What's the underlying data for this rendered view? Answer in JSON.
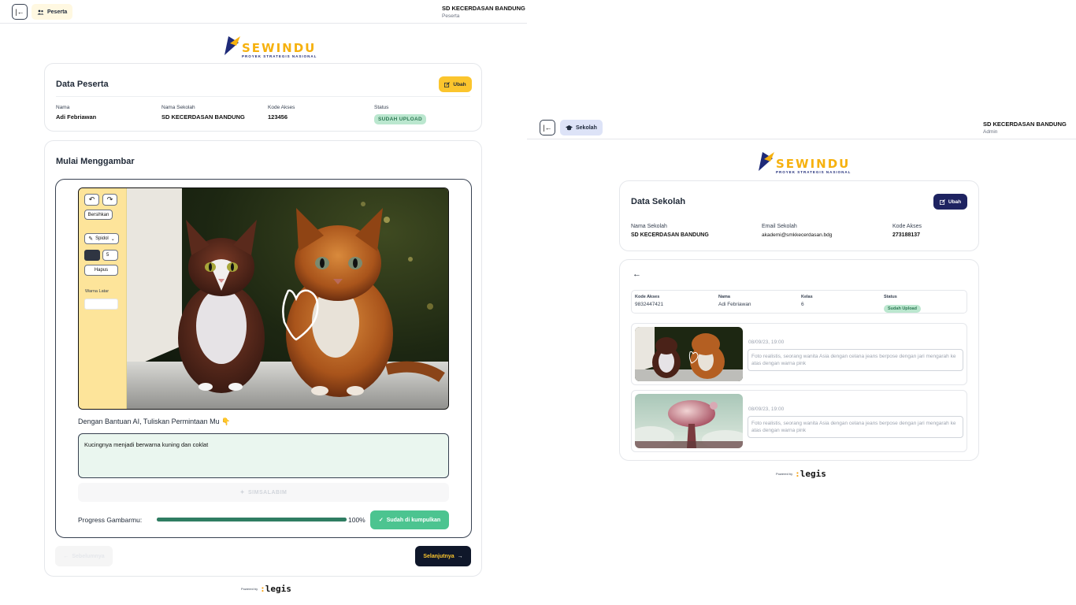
{
  "left": {
    "nav_chip": "Peserta",
    "org_name": "SD KECERDASAN BANDUNG",
    "org_role": "Peserta",
    "logo": {
      "word": "SEWINDU",
      "tagline": "PROYEK STRATEGIS NASIONAL"
    },
    "participant": {
      "title": "Data Peserta",
      "edit_label": "Ubah",
      "fields": [
        {
          "label": "Nama",
          "value": "Adi Febriawan"
        },
        {
          "label": "Nama Sekolah",
          "value": "SD KECERDASAN BANDUNG"
        },
        {
          "label": "Kode Akses",
          "value": "123456"
        },
        {
          "label": "Status",
          "value": "SUDAH UPLOAD"
        }
      ]
    },
    "drawing": {
      "title": "Mulai Menggambar",
      "tools": {
        "clear": "Bersihkan",
        "brush": "Spidol",
        "size": "5",
        "erase": "Hapus",
        "bg_label": "Warna Latar",
        "brush_color": "#2f3542",
        "bg_color": "#ffffff"
      },
      "prompt_label": "Dengan Bantuan AI, Tuliskan Permintaan Mu",
      "prompt_emoji": "👇",
      "prompt_value": "Kucingnya menjadi berwarna kuning dan coklat",
      "generate_label": "SIMSALABIM",
      "progress_label": "Progress Gambarmu:",
      "progress_value": 1.0,
      "progress_text": "100%",
      "submitted_label": "Sudah di kumpulkan"
    },
    "nav": {
      "prev_label": "Sebelumnya",
      "next_label": "Selanjutnya"
    },
    "powered": {
      "by": "Powered by",
      "brand": "legis"
    }
  },
  "right": {
    "nav_chip": "Sekolah",
    "org_name": "SD KECERDASAN BANDUNG",
    "org_role": "Admin",
    "logo": {
      "word": "SEWINDU",
      "tagline": "PROYEK STRATEGIS NASIONAL"
    },
    "school": {
      "title": "Data Sekolah",
      "edit_label": "Ubah",
      "fields": [
        {
          "label": "Nama Sekolah",
          "value": "SD KECERDASAN BANDUNG"
        },
        {
          "label": "Email Sekolah",
          "value": "akademi@smkkecerdasan.bdg"
        },
        {
          "label": "Kode Akses",
          "value": "273188137"
        }
      ]
    },
    "student": {
      "cols": [
        {
          "label": "Kode Akses",
          "value": "9832447421"
        },
        {
          "label": "Nama",
          "value": "Adi Febriawan"
        },
        {
          "label": "Kelas",
          "value": "6"
        },
        {
          "label": "Status",
          "value": "Sudah Upload"
        }
      ]
    },
    "history": [
      {
        "date": "08/09/23, 19:00",
        "desc": "Foto realistis, seorang wanita Asia dengan celana jeans berpose dengan jari mengarah ke atas dengan warna pink"
      },
      {
        "date": "08/09/23, 19:00",
        "desc": "Foto realistis, seorang wanita Asia dengan celana jeans berpose dengan jari mengarah ke atas dengan warna pink"
      }
    ],
    "powered": {
      "by": "Powered by",
      "brand": "legis"
    }
  },
  "colors": {
    "accent_yellow": "#fbc52d",
    "navy": "#1e2361",
    "green": "#4cc490",
    "badge_green": "#bbe7cf"
  }
}
